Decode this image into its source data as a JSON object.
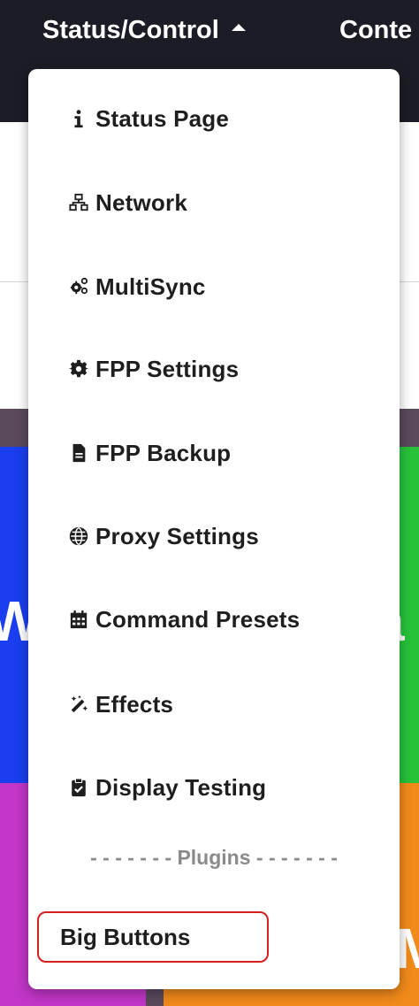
{
  "navbar": {
    "status_control": "Status/Control",
    "content": "Conte"
  },
  "dropdown": {
    "items": [
      {
        "label": "Status Page",
        "icon": "info-icon"
      },
      {
        "label": "Network",
        "icon": "network-icon"
      },
      {
        "label": "MultiSync",
        "icon": "gears-icon"
      },
      {
        "label": "FPP Settings",
        "icon": "gear-icon"
      },
      {
        "label": "FPP Backup",
        "icon": "file-icon"
      },
      {
        "label": "Proxy Settings",
        "icon": "globe-icon"
      },
      {
        "label": "Command Presets",
        "icon": "calendar-icon"
      },
      {
        "label": "Effects",
        "icon": "magic-wand-icon"
      },
      {
        "label": "Display Testing",
        "icon": "clipboard-check-icon"
      }
    ],
    "divider_label": "- - - - - - - Plugins - - - - - - -",
    "plugin_item": "Big Buttons"
  },
  "background_tiles": {
    "blue_letter": "W",
    "green_letter": "a",
    "orange_letter": "M"
  },
  "colors": {
    "navbar": "#1c1c26",
    "highlight_border": "#d61f1f",
    "tile_blue": "#1a3ef0",
    "tile_green": "#27c23a",
    "tile_pink": "#c236c8",
    "tile_orange": "#f08a1a"
  }
}
